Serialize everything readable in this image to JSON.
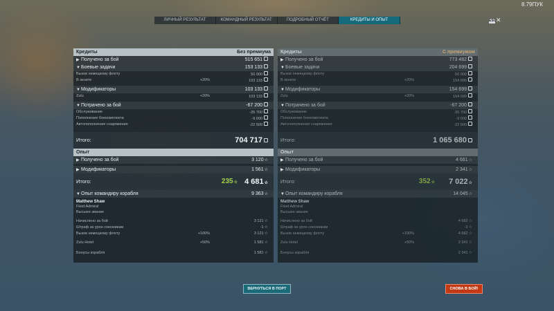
{
  "version": "8.79ПУК",
  "esc_label": "ESC",
  "close_glyph": "✕",
  "tabs": [
    "ЛИЧНЫЙ РЕЗУЛЬТАТ",
    "КОМАНДНЫЙ РЕЗУЛЬТАТ",
    "ПОДРОБНЫЙ ОТЧЁТ",
    "КРЕДИТЫ И ОПЫТ"
  ],
  "active_tab": 3,
  "left": {
    "credits_title": "Кредиты",
    "credits_mode": "Без премиума",
    "earned_label": "Получено за бой",
    "earned_value": "515 651",
    "missions_label": "Боевые задачи",
    "missions_value": "153 133",
    "missions_sub": [
      {
        "label": "Вызов немецкому флоту",
        "pct": "",
        "value": "50 000"
      },
      {
        "label": "В зените",
        "pct": "+20%",
        "value": "103 133"
      }
    ],
    "mods_label": "Модификаторы",
    "mods_value": "103 133",
    "mods_sub": [
      {
        "label": "Zulu",
        "pct": "+20%",
        "value": "103 133"
      }
    ],
    "spent_label": "Потрачено за бой",
    "spent_value": "-67 200",
    "spent_sub": [
      {
        "label": "Обслуживание",
        "value": "-35 700"
      },
      {
        "label": "Пополнение боекомплекта",
        "value": "-9 000"
      },
      {
        "label": "Автопополнение снаряжения",
        "value": "-22 500"
      }
    ],
    "total_label": "Итого:",
    "total_value": "704 717",
    "exp_title": "Опыт",
    "exp_earned_label": "Получено за бой",
    "exp_earned_value": "3 120",
    "exp_mods_label": "Модификаторы",
    "exp_mods_value": "1 561",
    "exp_total_label": "Итого:",
    "exp_free": "235",
    "exp_total": "4 681",
    "cmd_label": "Опыт командиру корабля",
    "cmd_value": "9 363",
    "cmd_name": "Matthew Shaw",
    "cmd_rank": "Fleet Admiral",
    "cmd_rank2": "Высшее звание",
    "cmd_rows": [
      {
        "label": "Начислено за бой",
        "pct": "",
        "value": "3 121"
      },
      {
        "label": "Штраф за урон союзникам",
        "pct": "",
        "value": "-1"
      },
      {
        "label": "Вызов немецкому флоту",
        "pct": "+100%",
        "value": "3 121"
      },
      {
        "label": "Zulu Hotel",
        "pct": "+50%",
        "value": "1 581"
      },
      {
        "label": "Бонусы корабля",
        "pct": "",
        "value": "1 581"
      }
    ]
  },
  "right": {
    "credits_title": "Кредиты",
    "credits_mode": "С премиумом",
    "earned_label": "Получено за бой",
    "earned_value": "773 482",
    "missions_label": "Боевые задачи",
    "missions_value": "204 699",
    "missions_sub": [
      {
        "label": "Вызов немецкому флоту",
        "pct": "",
        "value": "50 000"
      },
      {
        "label": "В зените",
        "pct": "+20%",
        "value": "154 699"
      }
    ],
    "mods_label": "Модификаторы",
    "mods_value": "154 699",
    "mods_sub": [
      {
        "label": "Zulu",
        "pct": "+20%",
        "value": "154 699"
      }
    ],
    "spent_label": "Потрачено за бой",
    "spent_value": "-67 200",
    "spent_sub": [
      {
        "label": "Обслуживание",
        "value": "-35 700"
      },
      {
        "label": "Пополнение боекомплекта",
        "value": "-9 000"
      },
      {
        "label": "Автопополнение снаряжения",
        "value": "-22 500"
      }
    ],
    "total_label": "Итого:",
    "total_value": "1 065 680",
    "exp_title": "Опыт",
    "exp_earned_label": "Получено за бой",
    "exp_earned_value": "4 681",
    "exp_mods_label": "Модификаторы",
    "exp_mods_value": "2 341",
    "exp_total_label": "Итого:",
    "exp_free": "352",
    "exp_total": "7 022",
    "cmd_label": "Опыт командиру корабля",
    "cmd_value": "14 045",
    "cmd_name": "Matthew Shaw",
    "cmd_rank": "Fleet Admiral",
    "cmd_rank2": "Высшее звание",
    "cmd_rows": [
      {
        "label": "Начислено за бой",
        "pct": "",
        "value": "4 682"
      },
      {
        "label": "Штраф за урон союзникам",
        "pct": "",
        "value": "-1"
      },
      {
        "label": "Вызов немецкому флоту",
        "pct": "+100%",
        "value": "4 682"
      },
      {
        "label": "Zulu Hotel",
        "pct": "+50%",
        "value": "2 341"
      },
      {
        "label": "Бонусы корабля",
        "pct": "",
        "value": "2 341"
      }
    ]
  },
  "buttons": {
    "port": "ВЕРНУТЬСЯ В ПОРТ",
    "battle": "СНОВА В БОЙ!"
  }
}
